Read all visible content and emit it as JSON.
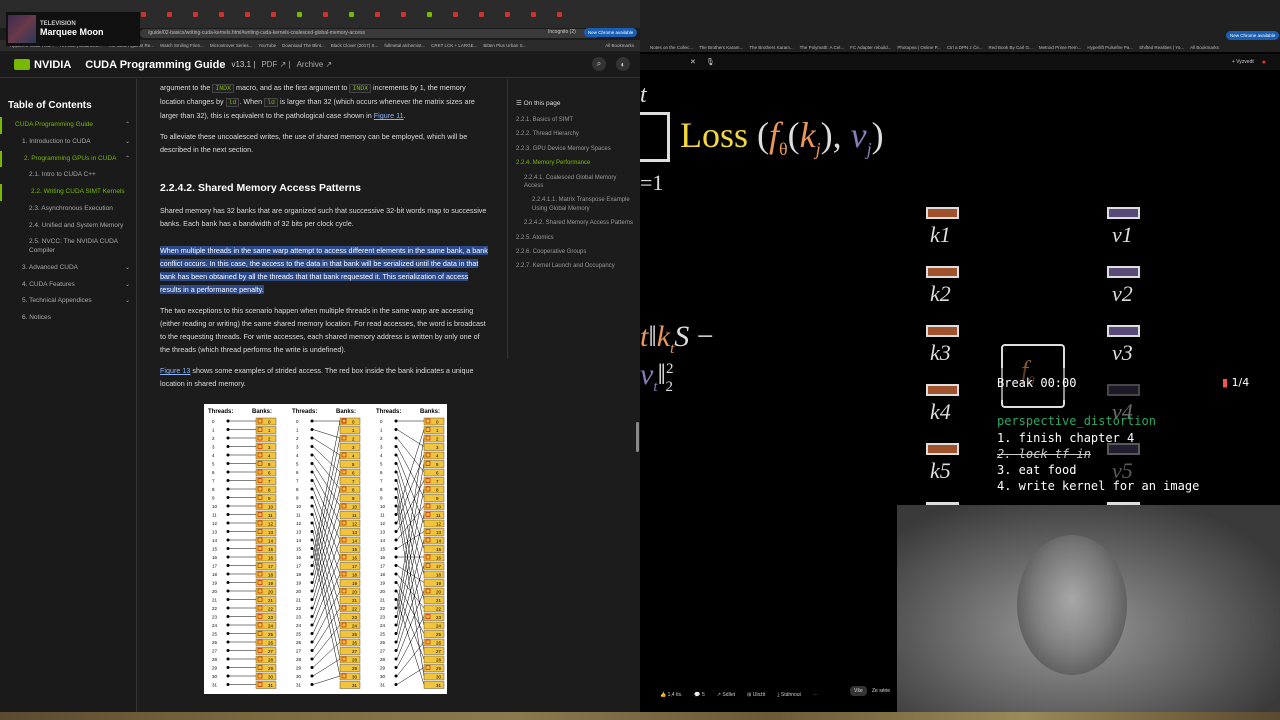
{
  "twitch": {
    "category": "TELEVISION",
    "title": "Marquee Moon"
  },
  "browser_left": {
    "address": "/guide/02-basics/writing-cuda-kernels.html#writing-cuda-kernels-coalesced-global-memory-access",
    "incognito": "Incognito (2)",
    "update": "New Chrome available",
    "bookmarks": [
      "Apparent Initial Trou...",
      "AR.skin | Balanced...",
      "The Case Against Re...",
      "Watch Smiling Frien...",
      "Microstrover Series...",
      "YouTube",
      "Download The Blint...",
      "Black Clover (2017) S...",
      "fullmetal alchemist...",
      "CRKT LCK + LARGE...",
      "Bitten Plus Urban S...",
      "All Bookmarks"
    ]
  },
  "nvidia": {
    "logo": "NVIDIA",
    "title": "CUDA Programming Guide",
    "version": "v13.1",
    "pdf": "PDF",
    "archive": "Archive"
  },
  "toc": {
    "heading": "Table of Contents",
    "items": [
      {
        "label": "CUDA Programming Guide",
        "level": 0
      },
      {
        "label": "1. Introduction to CUDA",
        "level": 1
      },
      {
        "label": "2. Programming GPUs in CUDA",
        "level": 1
      },
      {
        "label": "2.1. Intro to CUDA C++",
        "level": 2
      },
      {
        "label": "2.2. Writing CUDA SIMT Kernels",
        "level": 2
      },
      {
        "label": "2.3. Asynchronous Execution",
        "level": 2
      },
      {
        "label": "2.4. Unified and System Memory",
        "level": 2
      },
      {
        "label": "2.5. NVCC: The NVIDIA CUDA Compiler",
        "level": 2
      },
      {
        "label": "3. Advanced CUDA",
        "level": 1
      },
      {
        "label": "4. CUDA Features",
        "level": 1
      },
      {
        "label": "5. Technical Appendices",
        "level": 1
      },
      {
        "label": "6. Notices",
        "level": 1
      }
    ]
  },
  "content": {
    "p1a": "argument to the",
    "p1code1": "INDX",
    "p1b": "macro, and as the first argument to",
    "p1code2": "INDX",
    "p1c": "increments by 1, the memory location changes by",
    "p1code3": "ld",
    "p1d": ". When",
    "p1code4": "ld",
    "p1e": "is larger than 32 (which occurs whenever the matrix sizes are larger than 32), this is equivalent to the pathological case shown in",
    "p1link": "Figure 11",
    "p2": "To alleviate these uncoalesced writes, the use of shared memory can be employed, which will be described in the next section.",
    "heading": "2.2.4.2. Shared Memory Access Patterns",
    "p3": "Shared memory has 32 banks that are organized such that successive 32-bit words map to successive banks. Each bank has a bandwidth of 32 bits per clock cycle.",
    "p4": "When multiple threads in the same warp attempt to access different elements in the same bank, a bank conflict occurs. In this case, the access to the data in that bank will be serialized until the data in that bank has been obtained by all the threads that that bank requested it. This serialization of access results in a performance penalty.",
    "p5": "The two exceptions to this scenario happen when multiple threads in the same warp are accessing (either reading or writing) the same shared memory location. For read accesses, the word is broadcast to the requesting threads. For write accesses, each shared memory address is written by only one of the threads (which thread performs the write is undefined).",
    "p6link": "Figure 13",
    "p6": "shows some examples of strided access. The red box inside the bank indicates a unique location in shared memory.",
    "fig_threads": "Threads:",
    "fig_banks": "Banks:"
  },
  "otp": {
    "heading": "On this page",
    "items": [
      {
        "label": "2.2.1. Basics of SIMT",
        "indent": 0
      },
      {
        "label": "2.2.2. Thread Hierarchy",
        "indent": 0
      },
      {
        "label": "2.2.3. GPU Device Memory Spaces",
        "indent": 0
      },
      {
        "label": "2.2.4. Memory Performance",
        "indent": 0
      },
      {
        "label": "2.2.4.1. Coalesced Global Memory Access",
        "indent": 1
      },
      {
        "label": "2.2.4.1.1. Matrix Transpose Example Using Global Memory",
        "indent": 2
      },
      {
        "label": "2.2.4.2. Shared Memory Access Patterns",
        "indent": 1
      },
      {
        "label": "2.2.5. Atomics",
        "indent": 0
      },
      {
        "label": "2.2.6. Cooperative Groups",
        "indent": 0
      },
      {
        "label": "2.2.7. Kernel Launch and Occupancy",
        "indent": 0
      }
    ]
  },
  "browser_right": {
    "bookmarks": [
      "Notes on the Collec...",
      "The Brothers Karam...",
      "The Brothers Karam...",
      "The Polymath: A Cel...",
      "FC Adapter rebuild...",
      "Photopea | Online P...",
      "Ctrl a DPN z Če...",
      "Red Book By Carl G...",
      "Metroid Prime Rem...",
      "Hyperlift Pulsefire Pa...",
      "Shifted Realities | Yo...",
      "All Bookmarks"
    ],
    "signin": "Vyzvedt",
    "update": "New Chrome available"
  },
  "video": {
    "loss_text": "Loss",
    "k_labels": [
      "k1",
      "k2",
      "k3",
      "k4",
      "k5"
    ],
    "v_labels": [
      "v1",
      "v2",
      "v3",
      "v4",
      "v5"
    ],
    "break_timer": "Break 00:00",
    "page_counter": "1/4",
    "tag": "perspective_distortion",
    "todo": [
      "1. finish chapter 4",
      "2. lock tf in",
      "3. eat food",
      "4. write kernel for an image"
    ],
    "likes": "1,4 tis.",
    "comments": "5",
    "share": "Sdílet",
    "save": "Uložit",
    "download": "Stáhnout",
    "chip1": "Vše",
    "chip2": "Ze série"
  }
}
